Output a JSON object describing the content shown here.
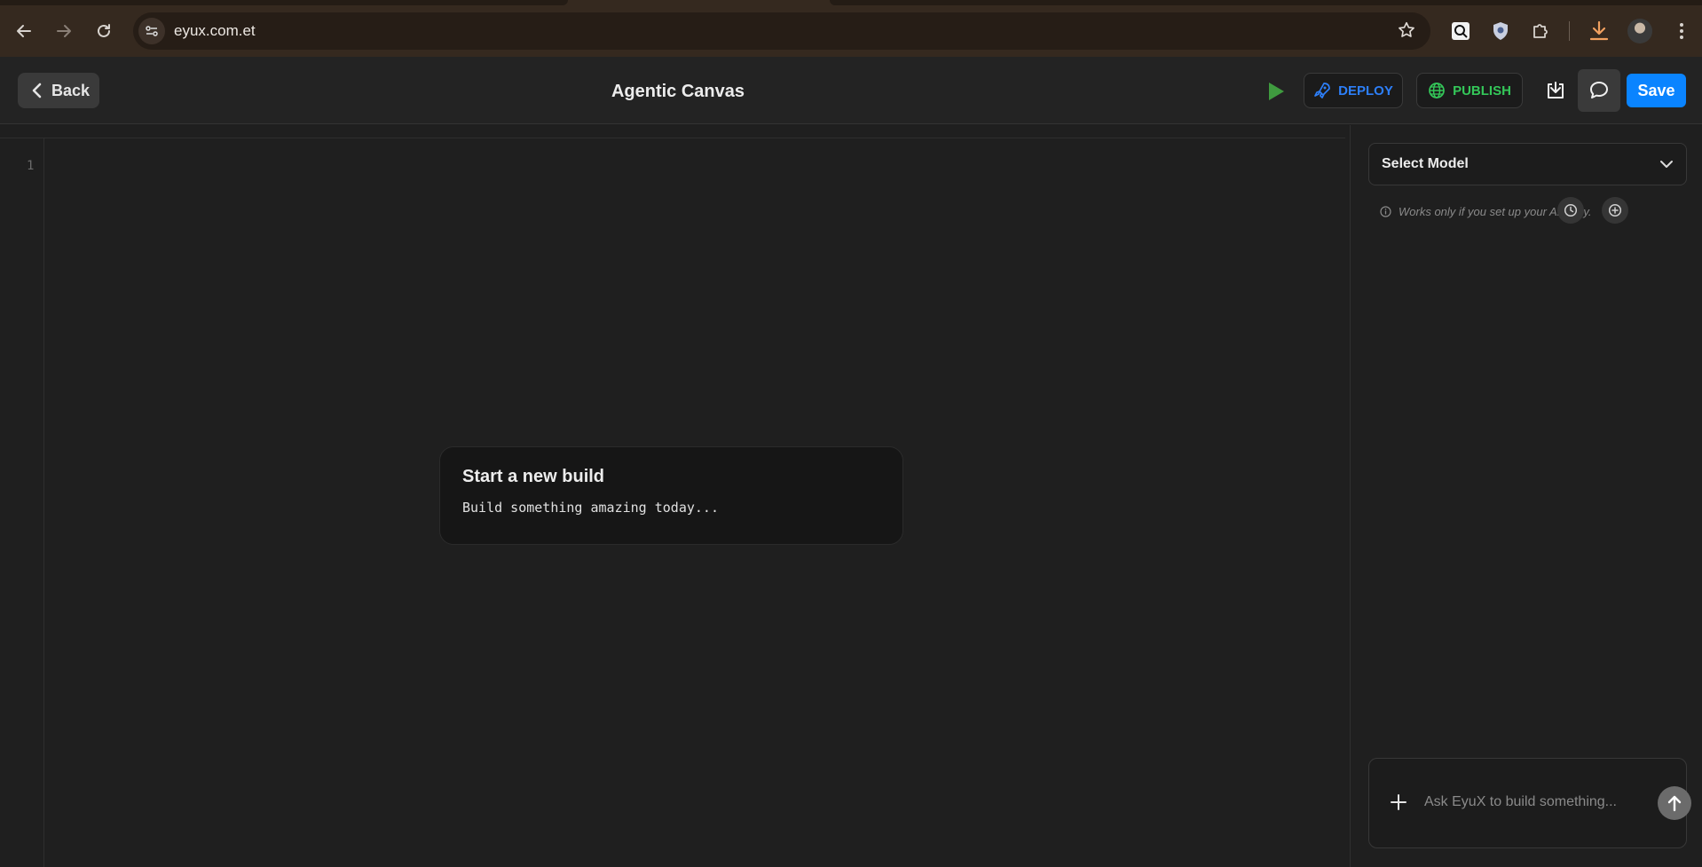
{
  "browser": {
    "url": "eyux.com.et"
  },
  "header": {
    "back_label": "Back",
    "title": "Agentic Canvas",
    "deploy_label": "DEPLOY",
    "publish_label": "PUBLISH",
    "save_label": "Save"
  },
  "editor": {
    "line_numbers": [
      "1"
    ],
    "empty_state": {
      "title": "Start a new build",
      "subtitle": "Build something amazing today..."
    }
  },
  "side_panel": {
    "model_select_label": "Select Model",
    "api_note": "Works only if you set up your API key.",
    "composer_placeholder": "Ask EyuX to build something..."
  },
  "colors": {
    "accent_blue": "#0a84ff",
    "deploy_blue": "#2d7ff9",
    "publish_green": "#34c759",
    "run_green": "#3f9b3f",
    "download_orange": "#f0a060"
  },
  "icons": [
    "back-arrow-icon",
    "forward-arrow-icon",
    "reload-icon",
    "site-settings-icon",
    "bookmark-star-icon",
    "search-lens-extension-icon",
    "shield-extension-icon",
    "puzzle-extensions-icon",
    "download-icon",
    "profile-avatar",
    "kebab-menu-icon",
    "chevron-left-icon",
    "play-icon",
    "rocket-icon",
    "globe-icon",
    "download-tray-icon",
    "chat-bubble-icon",
    "chevron-down-icon",
    "info-icon",
    "history-clock-icon",
    "plus-circle-icon",
    "plus-icon",
    "arrow-up-icon"
  ]
}
